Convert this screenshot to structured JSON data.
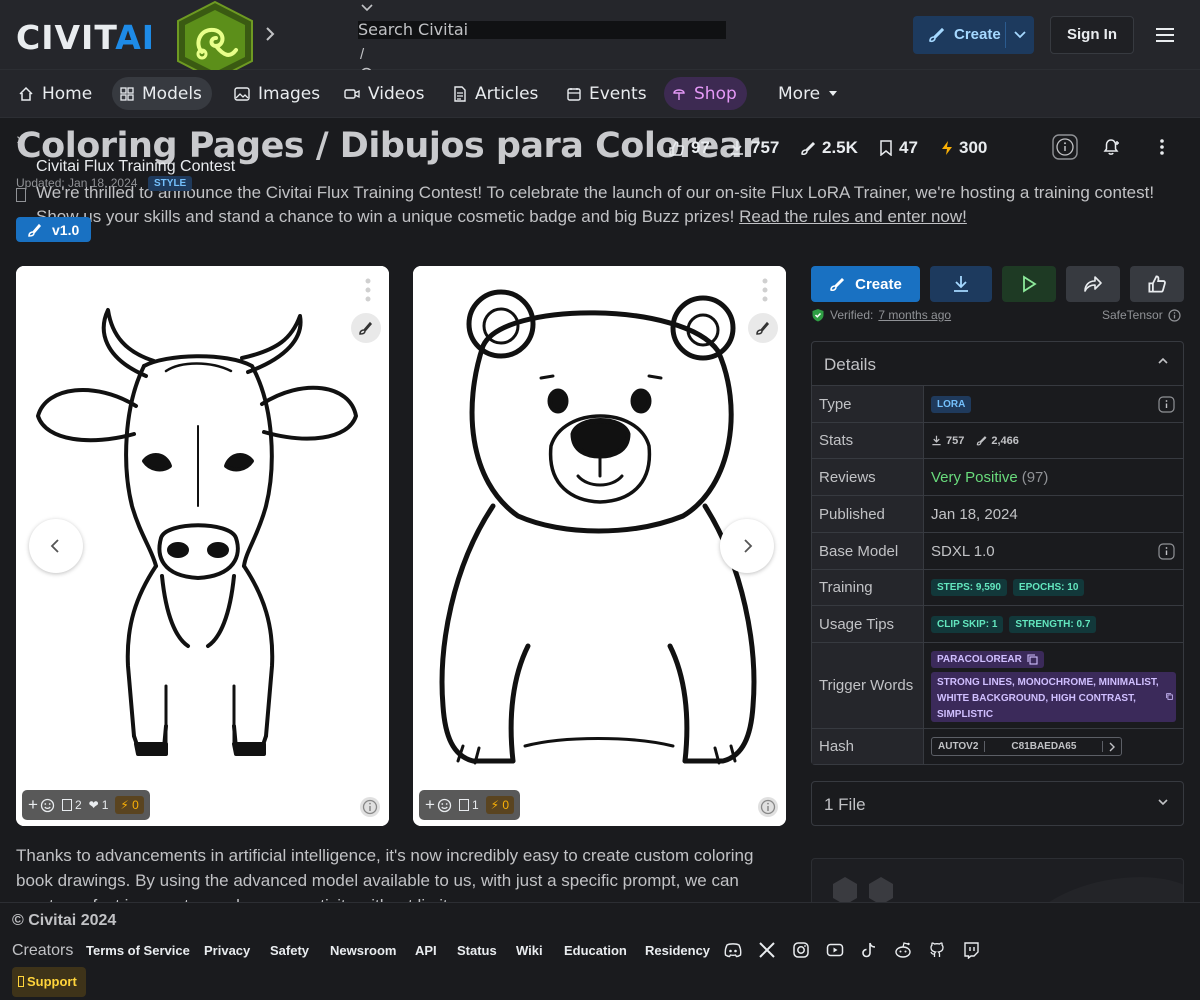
{
  "header": {
    "logo_main": "CIVIT",
    "logo_accent": "AI",
    "search_placeholder": "Search Civitai",
    "search_slash": "/",
    "create_label": "Create",
    "signin_label": "Sign In"
  },
  "nav": {
    "items": [
      {
        "label": "Home"
      },
      {
        "label": "Models"
      },
      {
        "label": "Images"
      },
      {
        "label": "Videos"
      },
      {
        "label": "Articles"
      },
      {
        "label": "Events"
      },
      {
        "label": "Shop"
      },
      {
        "label": "More"
      }
    ]
  },
  "model": {
    "title": "Coloring Pages / Dibujos para Colorear",
    "stats": {
      "likes": "97",
      "downloads": "757",
      "generations": "2.5K",
      "bookmarks": "47",
      "buzz": "300"
    },
    "contest_banner": "Civitai Flux Training Contest",
    "updated": "Updated: Jan 18, 2024",
    "style_tag": "STYLE",
    "announcement": "We're thrilled to announce the Civitai Flux Training Contest! To celebrate the launch of our on-site Flux LoRA Trainer, we're hosting a training contest! Show us your skills and stand a chance to win a unique cosmetic badge and big Buzz prizes!",
    "announcement_link": "Read the rules and enter now!",
    "version": "v1.0"
  },
  "gallery": {
    "cards": [
      {
        "subject": "cow",
        "comments": "2",
        "likes": "1",
        "buzz": "0"
      },
      {
        "subject": "bear",
        "comments": "1",
        "buzz": "0"
      }
    ]
  },
  "description": "Thanks to advancements in artificial intelligence, it's now incredibly easy to create custom coloring book drawings. By using the advanced model available to us, with just a specific prompt, we can create perfect images to spark your creativity without limits.",
  "actions": {
    "create_label": "Create",
    "verified_label": "Verified:",
    "verified_when": "7 months ago",
    "safetensor": "SafeTensor"
  },
  "details": {
    "heading": "Details",
    "rows": {
      "type": {
        "key": "Type",
        "value": "LORA"
      },
      "stats": {
        "key": "Stats",
        "downloads": "757",
        "generations": "2,466"
      },
      "reviews": {
        "key": "Reviews",
        "value": "Very Positive",
        "count": "(97)"
      },
      "published": {
        "key": "Published",
        "value": "Jan 18, 2024"
      },
      "base_model": {
        "key": "Base Model",
        "value": "SDXL 1.0"
      },
      "training": {
        "key": "Training",
        "steps": "STEPS: 9,590",
        "epochs": "EPOCHS: 10"
      },
      "usage_tips": {
        "key": "Usage Tips",
        "clip_skip": "CLIP SKIP: 1",
        "strength": "STRENGTH: 0.7"
      },
      "trigger_words": {
        "key": "Trigger Words",
        "word1": "PARACOLOREAR",
        "word2": "STRONG LINES, MONOCHROME, MINIMALIST, WHITE BACKGROUND, HIGH CONTRAST, SIMPLISTIC"
      },
      "hash": {
        "key": "Hash",
        "algo": "AUTOV2",
        "value": "C81BAEDA65"
      }
    }
  },
  "files": {
    "label": "1 File"
  },
  "footer": {
    "copyright": "© Civitai 2024",
    "creators": "Creators",
    "links": [
      "Terms of Service",
      "Privacy",
      "Safety",
      "Newsroom",
      "API",
      "Status",
      "Wiki",
      "Education",
      "Residency"
    ],
    "support": "Support"
  },
  "colors": {
    "accent": "#1971c2",
    "shop": "#e599f7",
    "positive": "#69db7c",
    "buzz": "#fab005"
  }
}
